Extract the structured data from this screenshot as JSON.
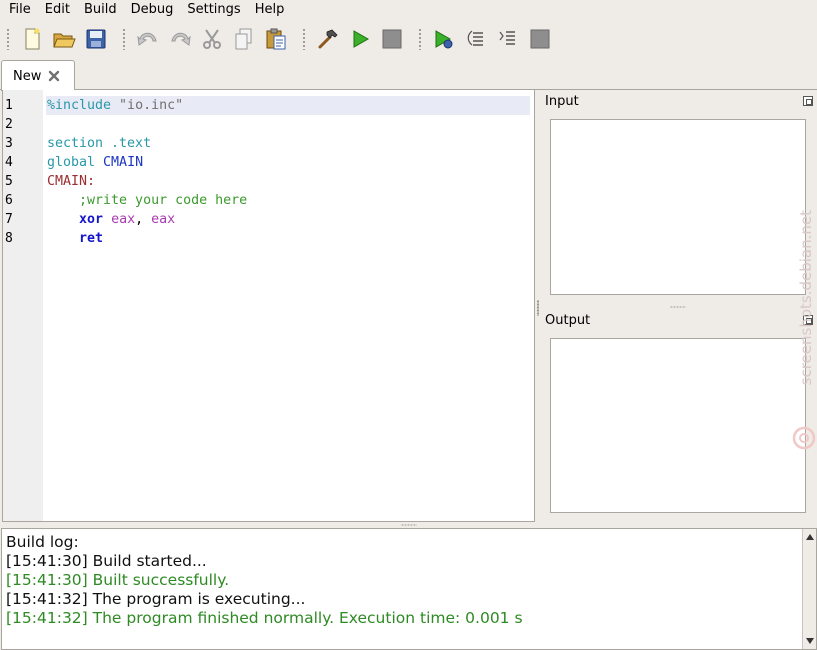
{
  "menu": {
    "items": [
      "File",
      "Edit",
      "Build",
      "Debug",
      "Settings",
      "Help"
    ]
  },
  "toolbar": {
    "buttons": [
      {
        "name": "new-file-icon"
      },
      {
        "name": "open-folder-icon"
      },
      {
        "name": "save-icon"
      },
      {
        "name": "undo-icon"
      },
      {
        "name": "redo-icon"
      },
      {
        "name": "cut-icon"
      },
      {
        "name": "copy-icon"
      },
      {
        "name": "paste-icon"
      },
      {
        "name": "build-hammer-icon"
      },
      {
        "name": "run-icon"
      },
      {
        "name": "stop-icon"
      },
      {
        "name": "debug-run-icon"
      },
      {
        "name": "step-over-icon"
      },
      {
        "name": "step-into-icon"
      },
      {
        "name": "debug-stop-icon"
      }
    ]
  },
  "tabs": [
    {
      "label": "New"
    }
  ],
  "editor": {
    "line_numbers": [
      "1",
      "2",
      "3",
      "4",
      "5",
      "6",
      "7",
      "8"
    ],
    "lines": {
      "l1_directive": "%include",
      "l1_string": " \"io.inc\"",
      "l3": "section .text",
      "l4_kw": "global ",
      "l4_name": "CMAIN",
      "l5": "CMAIN:",
      "l6": "    ;write your code here",
      "l7_kw": "xor",
      "l7_reg1": "eax",
      "l7_sep": ", ",
      "l7_reg2": "eax",
      "l8_kw": "ret"
    }
  },
  "panes": {
    "input_title": "Input",
    "output_title": "Output"
  },
  "build_log": {
    "lines": [
      "Build log:",
      "[15:41:30] Build started...",
      "[15:41:30] Built successfully.",
      "[15:41:32] The program is executing...",
      "[15:41:32] The program finished normally. Execution time: 0.001 s"
    ]
  },
  "watermark": {
    "text": "screenshots.debian.net"
  },
  "colors": {
    "success": "#2e8a23",
    "current_line": "#e8eaf6",
    "keyword": "#1515cc",
    "register": "#a83bb0",
    "comment": "#3c9a2e",
    "label": "#9b2e30",
    "directive": "#2a98a8"
  }
}
